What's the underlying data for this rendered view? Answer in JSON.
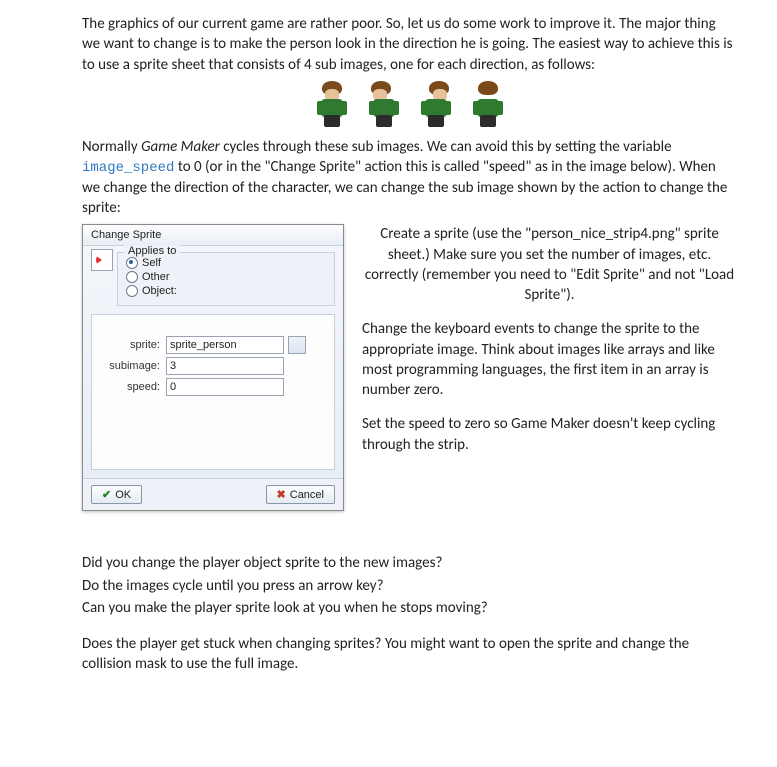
{
  "intro": "The graphics of our current game are rather poor.  So, let us do some work to improve it. The major thing we want to change is to make the person look in the direction he is going. The easiest way to achieve this is to use a sprite sheet that consists of 4 sub images, one for each direction, as follows:",
  "para2_pre": "Normally ",
  "para2_gm": "Game Maker",
  "para2_mid": " cycles through these sub images.  We can avoid this by setting the variable ",
  "para2_code": "image_speed",
  "para2_post": " to 0 (or in the \"Change Sprite\" action this is called \"speed\" as in the image below).  When we change the direction of the character, we can change the sub image shown by the action to change the sprite:",
  "dialog": {
    "title": "Change Sprite",
    "applies_to": "Applies to",
    "self": "Self",
    "other": "Other",
    "object": "Object:",
    "sprite_label": "sprite:",
    "sprite_value": "sprite_person",
    "subimage_label": "subimage:",
    "subimage_value": "3",
    "speed_label": "speed:",
    "speed_value": "0",
    "ok": "OK",
    "cancel": "Cancel"
  },
  "side": {
    "p1": "Create a sprite (use the \"person_nice_strip4.png\" sprite sheet.)  Make sure you set the number of images, etc. correctly (remember you need to \"Edit Sprite\" and not \"Load Sprite\").",
    "p2": "Change the keyboard events to change the sprite to the appropriate image.  Think about images like arrays and like most programming languages, the first item in an array is number zero.",
    "p3": "Set the speed to zero so Game Maker doesn't keep cycling through the strip."
  },
  "questions": {
    "q1": "Did you change the player object sprite to the new images?",
    "q2": "Do the images cycle until you press an arrow key?",
    "q3": "Can you make the player sprite look at you when he stops moving?"
  },
  "final": "Does the player get stuck when changing sprites?  You might want to open the sprite and change the collision mask to use the full image."
}
